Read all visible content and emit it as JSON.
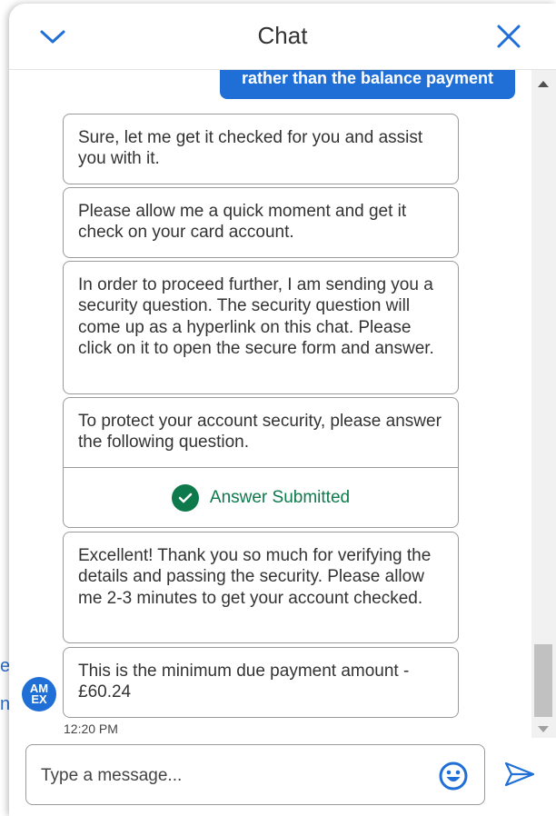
{
  "header": {
    "title": "Chat"
  },
  "backdrop": {
    "fragment_1": "e",
    "fragment_2": "n"
  },
  "messages": {
    "user_partial": "rather than the balance payment",
    "agent_1": "Sure, let me get it checked for you and assist you with it.",
    "agent_2": "Please allow me a quick moment and get it check on your card account.",
    "agent_3": "In order to proceed further, I am sending you a security question. The security question will come up as a hyperlink on this chat. Please click on it to open the secure form and answer.",
    "security_prompt": "To protect your account security, please answer the following question.",
    "security_status": "Answer Submitted",
    "agent_4": "Excellent! Thank you so much for verifying the details and passing the security. Please allow me 2-3 minutes to get your account checked.",
    "agent_5": "This is the minimum due payment amount - £60.24",
    "timestamp": "12:20 PM"
  },
  "avatar": {
    "line1": "AM",
    "line2": "EX"
  },
  "composer": {
    "placeholder": "Type a message..."
  },
  "icons": {
    "collapse": "chevron-down-icon",
    "close": "close-icon",
    "check": "checkmark-icon",
    "emoji": "smiley-icon",
    "send": "send-icon"
  },
  "colors": {
    "accent": "#1f6fd6",
    "success": "#0e7a4c"
  }
}
